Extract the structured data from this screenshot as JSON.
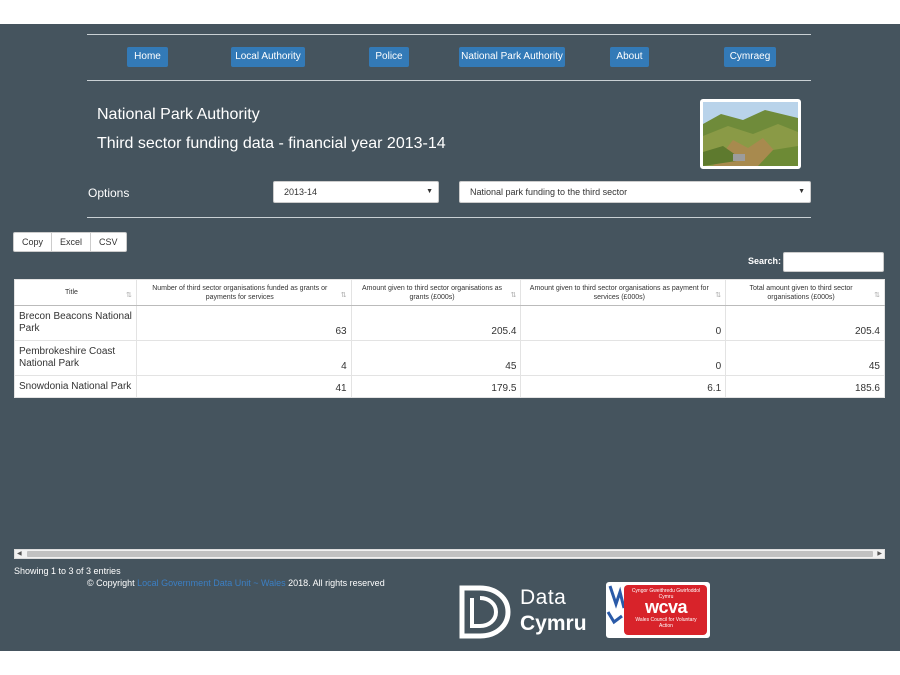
{
  "nav": {
    "items": [
      {
        "label": "Home"
      },
      {
        "label": "Local Authority"
      },
      {
        "label": "Police"
      },
      {
        "label": "National Park Authority"
      },
      {
        "label": "About"
      },
      {
        "label": "Cymraeg"
      }
    ]
  },
  "header": {
    "title": "National Park Authority",
    "subtitle": "Third sector funding data - financial year 2013-14"
  },
  "options": {
    "label": "Options",
    "year_selected": "2013-14",
    "dataset_selected": "National park funding to the third sector"
  },
  "export_buttons": [
    "Copy",
    "Excel",
    "CSV"
  ],
  "search": {
    "label": "Search:",
    "value": ""
  },
  "table": {
    "columns": [
      "Title",
      "Number of third sector organisations funded as grants or payments for services",
      "Amount given to third sector organisations as grants (£000s)",
      "Amount given to third sector organisations as payment for services (£000s)",
      "Total amount given to third sector organisations (£000s)"
    ],
    "rows": [
      [
        "Brecon Beacons National Park",
        "63",
        "205.4",
        "0",
        "205.4"
      ],
      [
        "Pembrokeshire Coast National Park",
        "4",
        "45",
        "0",
        "45"
      ],
      [
        "Snowdonia National Park",
        "41",
        "179.5",
        "6.1",
        "185.6"
      ]
    ]
  },
  "info": "Showing 1 to 3 of 3 entries",
  "footer": {
    "prefix": "© Copyright ",
    "link": "Local Government Data Unit ~ Wales",
    "suffix": " 2018. All rights reserved"
  },
  "logos": {
    "data_cymru": {
      "line1": "Data",
      "line2": "Cymru"
    },
    "wcva": {
      "top": "Cyngor Gweithredu Gwirfoddol Cymru",
      "big": "wcva",
      "bottom": "Wales Council for Voluntary Action"
    }
  },
  "colors": {
    "background": "#45545e",
    "accent": "#337ab7",
    "link": "#3b7fc4",
    "wcva_red": "#d8232a"
  }
}
